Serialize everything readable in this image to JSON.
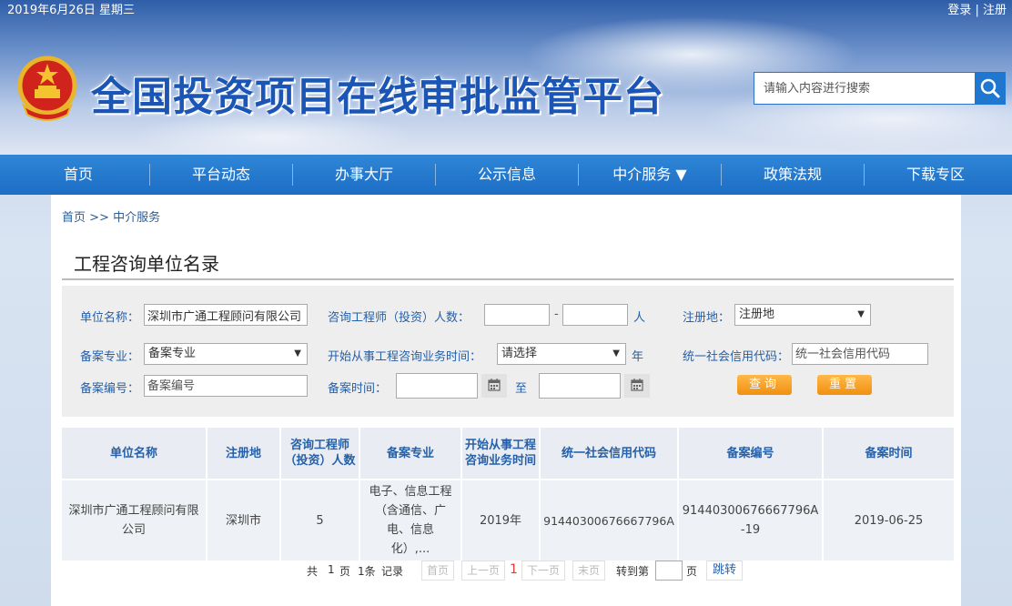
{
  "topbar": {
    "date": "2019年6月26日 星期三",
    "login": "登录",
    "separator": "|",
    "register": "注册"
  },
  "header": {
    "site_title": "全国投资项目在线审批监管平台",
    "search_placeholder": "请输入内容进行搜索"
  },
  "nav": {
    "items": [
      {
        "label": "首页"
      },
      {
        "label": "平台动态"
      },
      {
        "label": "办事大厅"
      },
      {
        "label": "公示信息"
      },
      {
        "label": "中介服务 ▼"
      },
      {
        "label": "政策法规"
      },
      {
        "label": "下载专区"
      }
    ]
  },
  "breadcrumb": {
    "home": "首页",
    "sep": ">>",
    "current": "中介服务"
  },
  "page_title": "工程咨询单位名录",
  "filter": {
    "unit_name_label": "单位名称：",
    "unit_name_value": "深圳市广通工程顾问有限公司",
    "engineer_count_label": "咨询工程师（投资）人数：",
    "range_dash": "-",
    "person_unit": "人",
    "reg_place_label": "注册地：",
    "reg_place_value": "注册地",
    "specialty_label": "备案专业：",
    "specialty_value": "备案专业",
    "start_time_label": "开始从事工程咨询业务时间：",
    "start_time_value": "请选择",
    "year_unit": "年",
    "credit_code_label": "统一社会信用代码：",
    "credit_code_placeholder": "统一社会信用代码",
    "record_no_label": "备案编号：",
    "record_no_placeholder": "备案编号",
    "record_time_label": "备案时间：",
    "to_label": "至",
    "query_button": "查询",
    "reset_button": "重置"
  },
  "table": {
    "headers": [
      "单位名称",
      "注册地",
      "咨询工程师（投资）人数",
      "备案专业",
      "开始从事工程咨询业务时间",
      "统一社会信用代码",
      "备案编号",
      "备案时间"
    ],
    "rows": [
      [
        "深圳市广通工程顾问有限公司",
        "深圳市",
        "5",
        "电子、信息工程（含通信、广电、信息化）,...",
        "2019年",
        "91440300676667796A",
        "91440300676667796A-19",
        "2019-06-25"
      ]
    ]
  },
  "pager": {
    "total_prefix": "共",
    "total_pages": "1",
    "page_unit": "页",
    "total_records": "1条",
    "record_unit": "记录",
    "first": "首页",
    "prev": "上一页",
    "current": "1",
    "next": "下一页",
    "last": "末页",
    "jump_to": "转到第",
    "jump_page_unit": "页",
    "go": "跳转"
  }
}
